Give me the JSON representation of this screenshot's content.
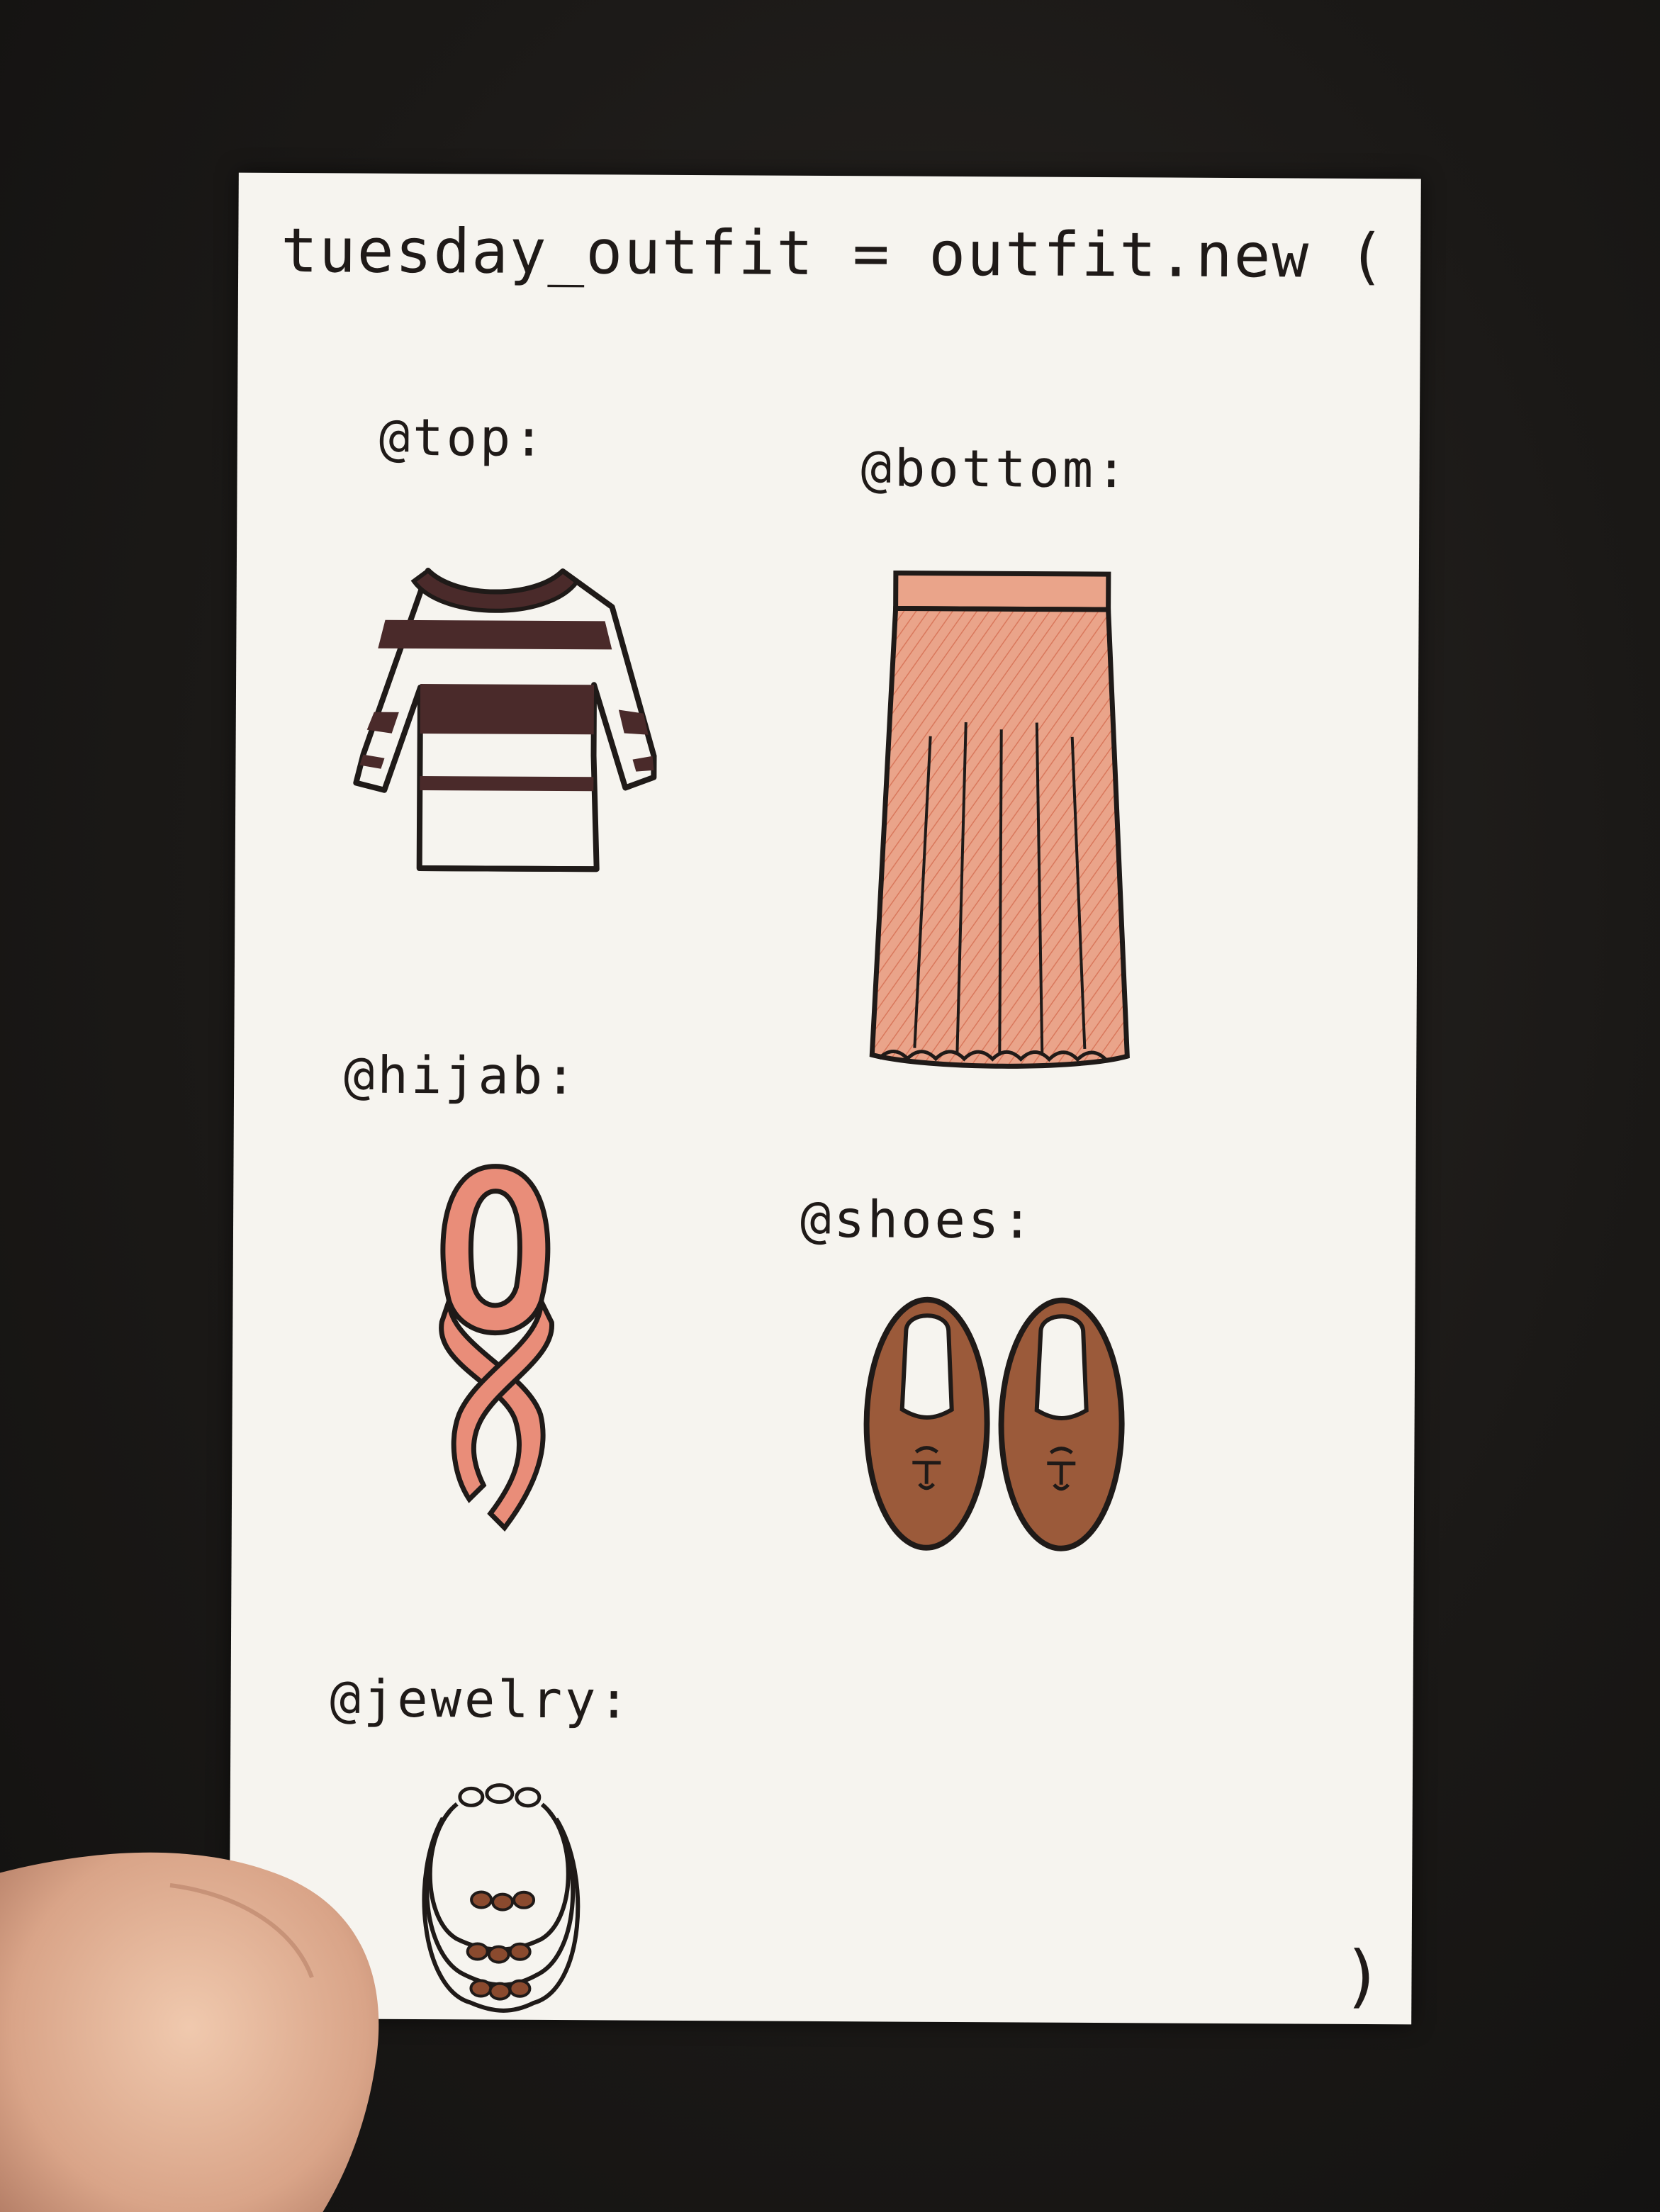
{
  "card": {
    "title": "tuesday_outfit = outfit.new (",
    "closing": ")"
  },
  "items": {
    "top": {
      "label": "@top:"
    },
    "bottom": {
      "label": "@bottom:"
    },
    "hijab": {
      "label": "@hijab:"
    },
    "shoes": {
      "label": "@shoes:"
    },
    "jewelry": {
      "label": "@jewelry:"
    }
  },
  "colors": {
    "card": "#f6f4ef",
    "ink": "#1f1a18",
    "stripe": "#4a2a2a",
    "skirt": "#e89a80",
    "hijab": "#e98d79",
    "shoe": "#9b5a3a",
    "bead": "#8a4a2e",
    "background": "#1c1a18"
  }
}
